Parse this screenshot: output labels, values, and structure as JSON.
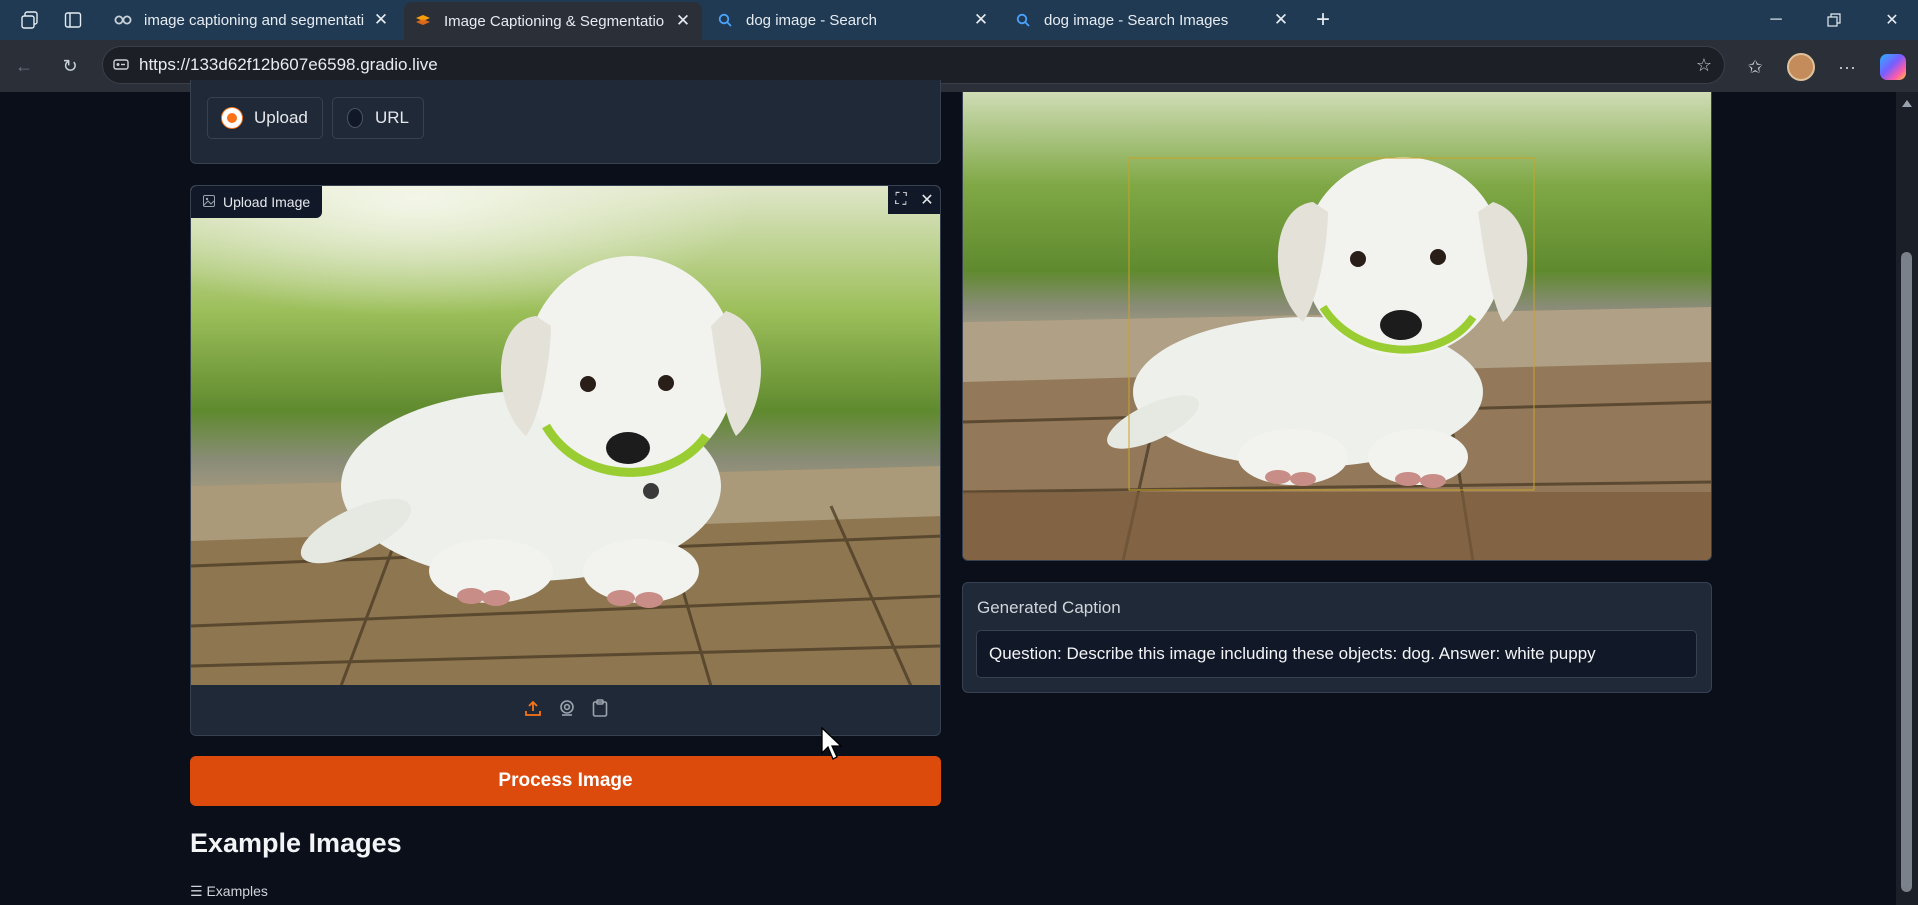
{
  "browser": {
    "tabs": [
      {
        "title": "image captioning and segmentati",
        "favicon": "link-icon",
        "active": false
      },
      {
        "title": "Image Captioning & Segmentatio",
        "favicon": "gradio-icon",
        "active": true
      },
      {
        "title": "dog image - Search",
        "favicon": "search-icon",
        "active": false
      },
      {
        "title": "dog image - Search Images",
        "favicon": "search-icon",
        "active": false
      }
    ],
    "url": "https://133d62f12b607e6598.gradio.live"
  },
  "input": {
    "source_options": [
      "Upload",
      "URL"
    ],
    "selected_source": "Upload",
    "image_label": "Upload Image",
    "source_icons": [
      "upload-icon",
      "webcam-icon",
      "clipboard-icon"
    ]
  },
  "process_button_label": "Process Image",
  "examples": {
    "heading": "Example Images",
    "sub_label": "Examples"
  },
  "output": {
    "caption_label": "Generated Caption",
    "caption_value": "Question: Describe this image including these objects: dog. Answer: white puppy"
  },
  "colors": {
    "accent": "#dc4a0c",
    "radio_on": "#f97316",
    "bbox": "#c9a227",
    "page_bg": "#0b0f19",
    "panel_bg": "#1f2937"
  }
}
